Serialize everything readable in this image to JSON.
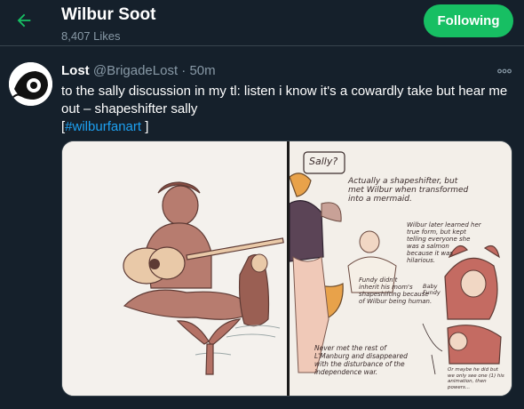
{
  "header": {
    "title": "Wilbur Soot",
    "subtitle": "8,407 Likes",
    "follow_label": "Following"
  },
  "tweet": {
    "name": "Lost",
    "handle": "@BrigadeLost",
    "separator": "·",
    "time": "50m",
    "text_line1": "to the sally discussion in my tl: listen i know it's a cowardly take but hear me",
    "text_line2": "out – shapeshifter sally",
    "hashtag_open": "[",
    "hashtag": "#wilburfanart",
    "hashtag_close": " ]"
  },
  "artwork": {
    "title": "Sally?",
    "note1": "Actually a shapeshifter, but\nmet Wilbur when transformed\ninto a mermaid.",
    "note2": "Wilbur later learned her\ntrue form, but kept\ntelling everyone she\nwas a salmon\nbecause it was\nhilarious.",
    "note3": "Fundy didn't\ninherit his mom's\nshapeshifting because\nof Wilbur being human.",
    "note4": "Never met the rest of\nL'Manburg and disappeared\nwith the disturbance of the\nindependence war.",
    "note5": "Or maybe he did but\nwe only see one (1) his\nanimation, then\npowers...",
    "bubble": "Baby\nFundy"
  },
  "colors": {
    "background": "#15202b",
    "accent": "#17bf63",
    "link": "#1da1f2",
    "muted": "#8899a6"
  },
  "icons": {
    "back": "arrow-left-icon",
    "more": "more-horizontal-icon"
  }
}
